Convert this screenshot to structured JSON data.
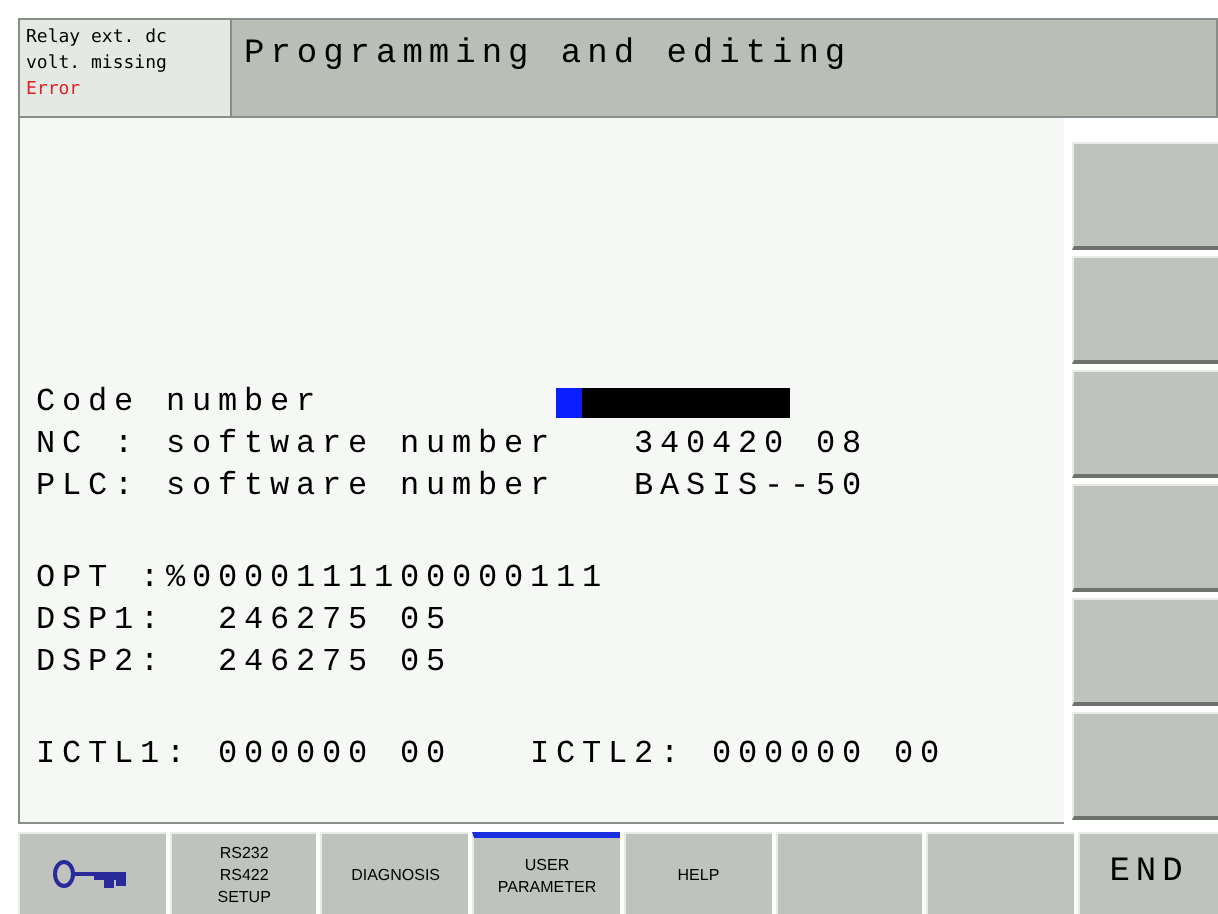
{
  "status": {
    "message": [
      "Relay ext. dc",
      "volt. missing"
    ],
    "level": "Error"
  },
  "mode_title": "Programming and editing",
  "code_number": {
    "label": "Code number"
  },
  "blocks": [
    [
      "NC : software number   340420 08",
      "PLC: software number   BASIS--50"
    ],
    [
      "OPT :%0000111100000111",
      "DSP1:  246275 05",
      "DSP2:  246275 05"
    ],
    [
      "ICTL1: 000000 00   ICTL2: 000000 00"
    ]
  ],
  "side_softkeys": [
    {
      "kind": "blank"
    },
    {
      "kind": "blank"
    },
    {
      "kind": "blank"
    },
    {
      "kind": "blank"
    },
    {
      "kind": "blank"
    },
    {
      "kind": "blank"
    }
  ],
  "softkeys": [
    {
      "kind": "key-icon",
      "selected": false
    },
    {
      "kind": "text",
      "lines": [
        "RS232",
        "RS422",
        "SETUP"
      ],
      "selected": false
    },
    {
      "kind": "text",
      "lines": [
        "DIAGNOSIS"
      ],
      "selected": false
    },
    {
      "kind": "text",
      "lines": [
        "USER",
        "PARAMETER"
      ],
      "selected": true
    },
    {
      "kind": "text",
      "lines": [
        "HELP"
      ],
      "selected": false
    },
    {
      "kind": "blank",
      "selected": false
    },
    {
      "kind": "blank",
      "selected": false
    },
    {
      "kind": "big",
      "lines": [
        "END"
      ],
      "selected": false
    }
  ]
}
